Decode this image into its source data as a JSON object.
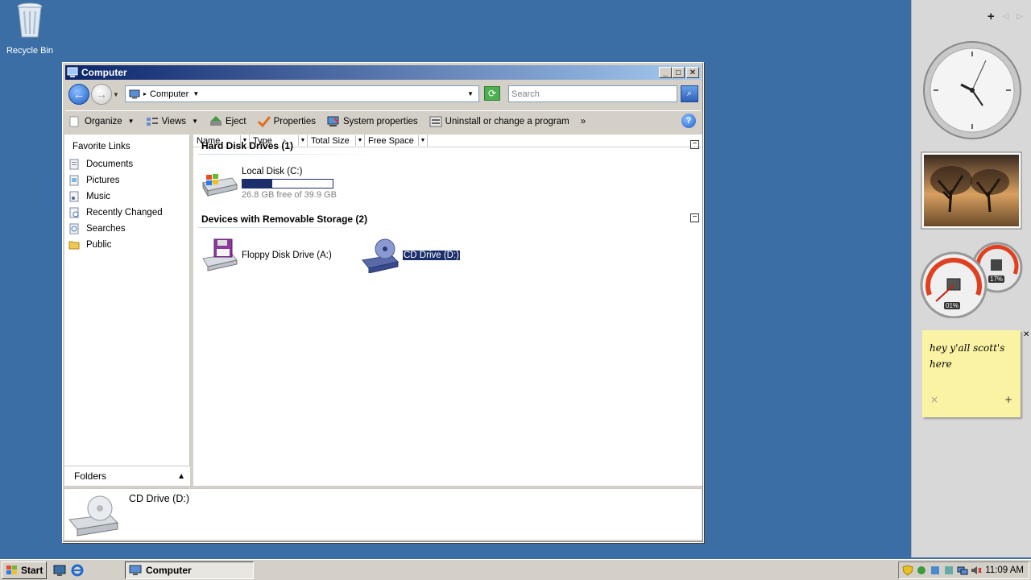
{
  "desktop": {
    "recycle_bin": "Recycle Bin"
  },
  "window": {
    "title": "Computer",
    "address": "Computer",
    "search_placeholder": "Search",
    "toolbar": {
      "organize": "Organize",
      "views": "Views",
      "eject": "Eject",
      "properties": "Properties",
      "system_properties": "System properties",
      "uninstall": "Uninstall or change a program",
      "more": "»"
    },
    "favorite_links": {
      "header": "Favorite Links",
      "items": [
        "Documents",
        "Pictures",
        "Music",
        "Recently Changed",
        "Searches",
        "Public"
      ]
    },
    "folders_label": "Folders",
    "columns": [
      "Name",
      "Type",
      "Total Size",
      "Free Space"
    ],
    "groups": {
      "hard_disk": "Hard Disk Drives (1)",
      "removable": "Devices with Removable Storage (2)"
    },
    "drives": {
      "c_name": "Local Disk (C:)",
      "c_free": "26.8 GB free of 39.9 GB",
      "c_used_fraction": 0.33,
      "a_name": "Floppy Disk Drive (A:)",
      "d_name": "CD Drive (D:)"
    },
    "details_name": "CD Drive (D:)"
  },
  "sidebar": {
    "add": "+",
    "prev": "◁",
    "next": "▷",
    "cpu_meter": "01%",
    "mem_meter": "17%",
    "note_text_1": "hey y'all scott's",
    "note_text_2": "here",
    "note_close": "×",
    "note_add": "+"
  },
  "taskbar": {
    "start": "Start",
    "task_computer": "Computer",
    "clock": "11:09 AM"
  }
}
